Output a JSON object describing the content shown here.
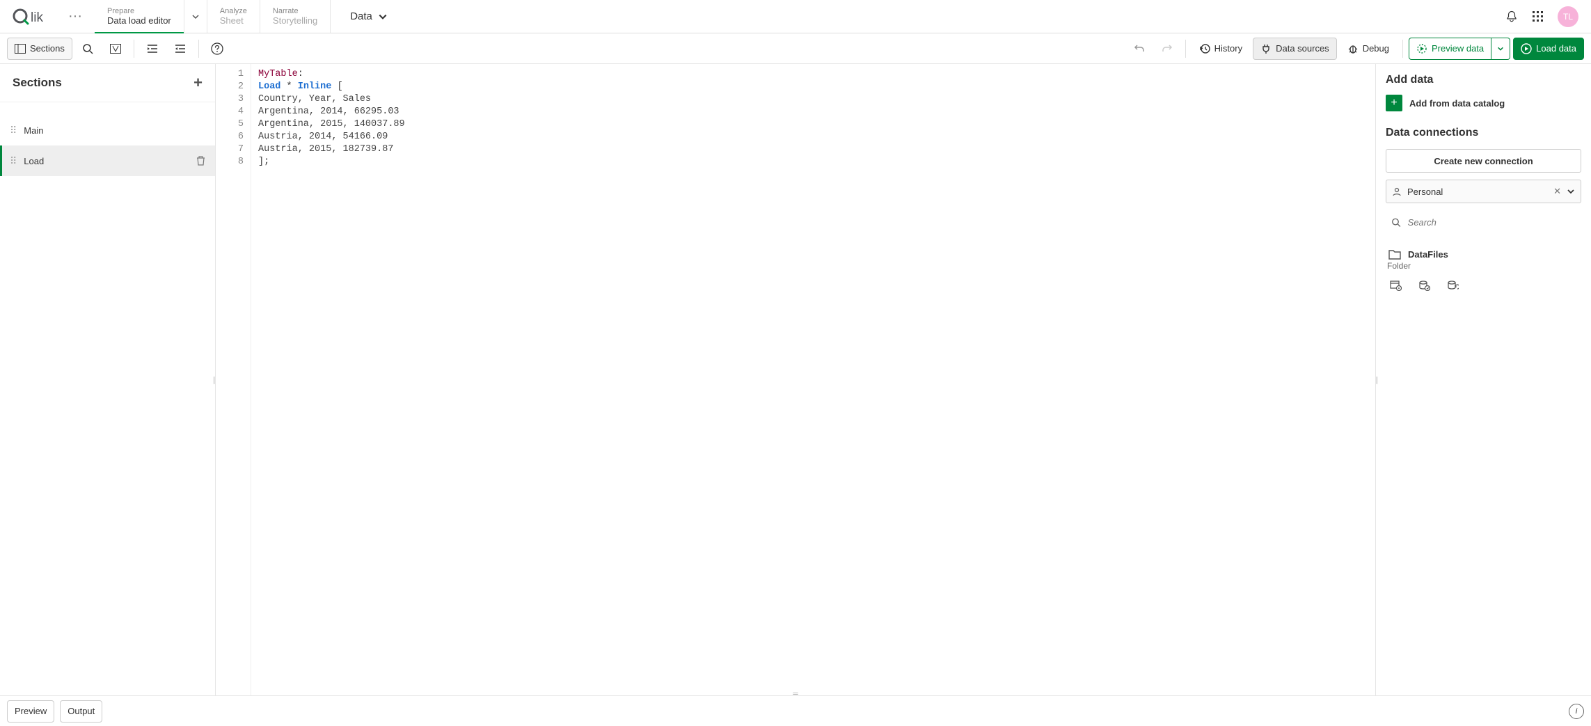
{
  "brand": {
    "name": "Qlik",
    "avatar_initials": "TL"
  },
  "nav": {
    "prepare": {
      "top": "Prepare",
      "bottom": "Data load editor"
    },
    "analyze": {
      "top": "Analyze",
      "bottom": "Sheet"
    },
    "narrate": {
      "top": "Narrate",
      "bottom": "Storytelling"
    },
    "center": "Data"
  },
  "toolbar": {
    "sections": "Sections",
    "history": "History",
    "data_sources": "Data sources",
    "debug": "Debug",
    "preview_data": "Preview data",
    "load_data": "Load data"
  },
  "sections_panel": {
    "title": "Sections",
    "items": [
      {
        "label": "Main"
      },
      {
        "label": "Load"
      }
    ]
  },
  "editor": {
    "lines": [
      "1",
      "2",
      "3",
      "4",
      "5",
      "6",
      "7",
      "8"
    ],
    "code": {
      "table_name": "MyTable",
      "load": "Load",
      "star": "*",
      "inline": "Inline",
      "open": "[",
      "header": "Country, Year, Sales",
      "rows": [
        "Argentina, 2014, 66295.03",
        "Argentina, 2015, 140037.89",
        "Austria, 2014, 54166.09",
        "Austria, 2015, 182739.87"
      ],
      "close": "];"
    }
  },
  "right_panel": {
    "add_data": "Add data",
    "add_from_catalog": "Add from data catalog",
    "data_connections": "Data connections",
    "create_new": "Create new connection",
    "space": "Personal",
    "search_placeholder": "Search",
    "conn_name": "DataFiles",
    "conn_type": "Folder"
  },
  "bottom": {
    "preview": "Preview",
    "output": "Output"
  }
}
